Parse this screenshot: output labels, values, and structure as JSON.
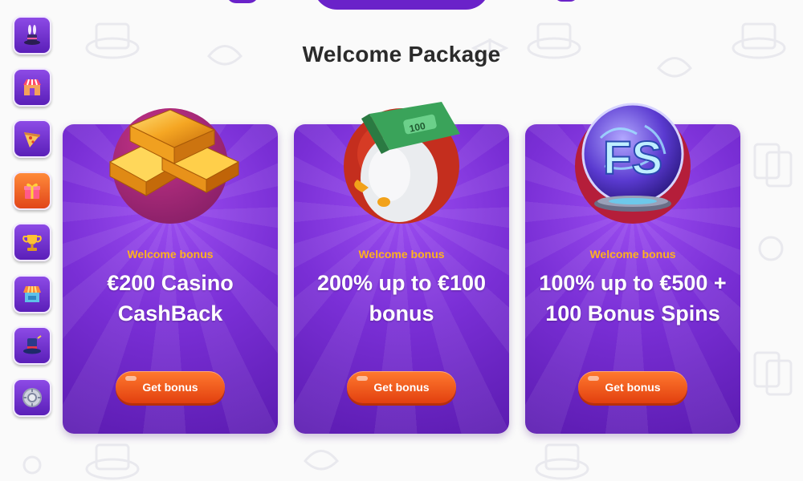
{
  "page": {
    "title": "Welcome Package"
  },
  "sidebar": {
    "items": [
      {
        "icon": "magic-hat-rabbit-icon"
      },
      {
        "icon": "shop-stall-icon"
      },
      {
        "icon": "pizza-slice-icon"
      },
      {
        "icon": "gift-icon"
      },
      {
        "icon": "trophy-icon"
      },
      {
        "icon": "market-stall-icon"
      },
      {
        "icon": "top-hat-icon"
      },
      {
        "icon": "safe-vault-icon"
      }
    ]
  },
  "cards": [
    {
      "label": "Welcome bonus",
      "offer": "€200 Casino CashBack",
      "button": "Get bonus",
      "art": "gold-bars-icon"
    },
    {
      "label": "Welcome bonus",
      "offer": "200% up to €100 bonus",
      "button": "Get bonus",
      "art": "money-roll-bird-icon"
    },
    {
      "label": "Welcome bonus",
      "offer": "100% up to €500 + 100 Bonus Spins",
      "button": "Get bonus",
      "art": "crystal-ball-fs-icon",
      "art_text": "FS"
    }
  ],
  "colors": {
    "accent_label": "#ffb21e",
    "card_purple": "#7a2fd6",
    "button_orange": "#ff7a2f",
    "title_text": "#2b2b2b"
  }
}
